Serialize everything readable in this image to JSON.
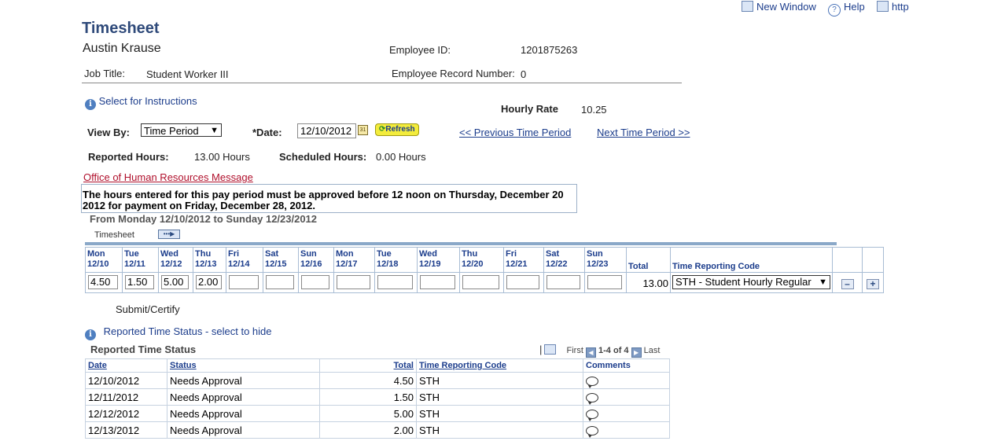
{
  "toplinks": {
    "new_window": "New Window",
    "help": "Help",
    "http": "http"
  },
  "header": {
    "title": "Timesheet",
    "employee_name": "Austin Krause",
    "employee_id_label": "Employee ID:",
    "employee_id": "1201875263",
    "job_title_label": "Job Title:",
    "job_title": "Student Worker III",
    "record_label": "Employee Record Number:",
    "record_number": "0"
  },
  "instructions_link": "Select for Instructions",
  "hourly_rate_label": "Hourly Rate",
  "hourly_rate": "10.25",
  "view_by": {
    "label": "View By:",
    "selected": "Time Period"
  },
  "date": {
    "label": "*Date:",
    "value": "12/10/2012"
  },
  "refresh_label": "Refresh",
  "prev_period": "<< Previous Time Period",
  "next_period": "Next Time Period >>",
  "reported_hours_label": "Reported Hours:",
  "reported_hours": "13.00 Hours",
  "scheduled_hours_label": "Scheduled Hours:",
  "scheduled_hours": "0.00 Hours",
  "hr_message_link": "Office of Human Resources Message",
  "hr_message_line1": "The hours entered for this pay period must be approved before 12 noon on Thursday, December 20",
  "hr_message_line2": "2012 for payment on Friday, December 28, 2012.",
  "period_range": "From Monday 12/10/2012 to Sunday 12/23/2012",
  "timesheet_tab": "Timesheet",
  "days": [
    {
      "dow": "Mon",
      "date": "12/10",
      "value": "4.50"
    },
    {
      "dow": "Tue",
      "date": "12/11",
      "value": "1.50"
    },
    {
      "dow": "Wed",
      "date": "12/12",
      "value": "5.00"
    },
    {
      "dow": "Thu",
      "date": "12/13",
      "value": "2.00"
    },
    {
      "dow": "Fri",
      "date": "12/14",
      "value": ""
    },
    {
      "dow": "Sat",
      "date": "12/15",
      "value": ""
    },
    {
      "dow": "Sun",
      "date": "12/16",
      "value": ""
    },
    {
      "dow": "Mon",
      "date": "12/17",
      "value": ""
    },
    {
      "dow": "Tue",
      "date": "12/18",
      "value": ""
    },
    {
      "dow": "Wed",
      "date": "12/19",
      "value": ""
    },
    {
      "dow": "Thu",
      "date": "12/20",
      "value": ""
    },
    {
      "dow": "Fri",
      "date": "12/21",
      "value": ""
    },
    {
      "dow": "Sat",
      "date": "12/22",
      "value": ""
    },
    {
      "dow": "Sun",
      "date": "12/23",
      "value": ""
    }
  ],
  "total_header": "Total",
  "total_value": "13.00",
  "trc_header": "Time Reporting Code",
  "trc_selected": "STH - Student Hourly Regular",
  "submit_label": "Submit/Certify",
  "status_toggle": "Reported Time Status - select to hide",
  "status_title": "Reported Time Status",
  "pager": {
    "first": "First",
    "range": "1-4 of 4",
    "last": "Last"
  },
  "status_headers": {
    "date": "Date",
    "status": "Status",
    "total": "Total",
    "trc": "Time Reporting Code",
    "comments": "Comments"
  },
  "status_rows": [
    {
      "date": "12/10/2012",
      "status": "Needs Approval",
      "total": "4.50",
      "trc": "STH"
    },
    {
      "date": "12/11/2012",
      "status": "Needs Approval",
      "total": "1.50",
      "trc": "STH"
    },
    {
      "date": "12/12/2012",
      "status": "Needs Approval",
      "total": "5.00",
      "trc": "STH"
    },
    {
      "date": "12/13/2012",
      "status": "Needs Approval",
      "total": "2.00",
      "trc": "STH"
    }
  ]
}
